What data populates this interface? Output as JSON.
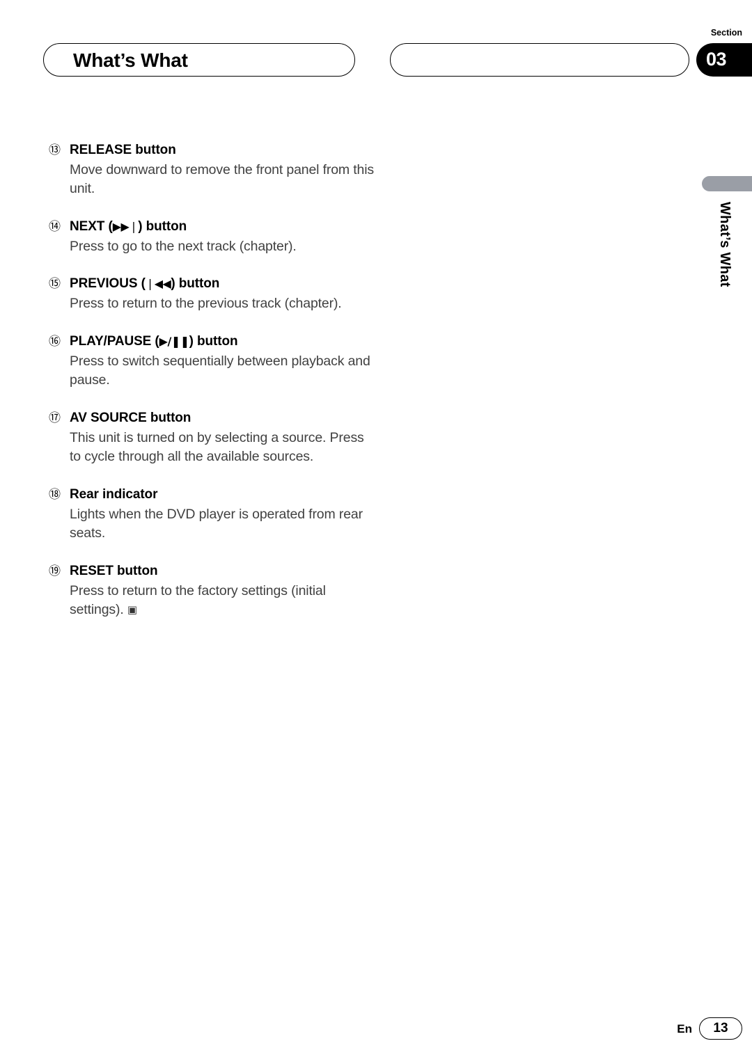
{
  "header": {
    "chapter_title": "What’s What",
    "section_label": "Section",
    "section_number": "03"
  },
  "side_tab": {
    "label": "What’s What",
    "color": "#9a9ea6"
  },
  "entries": [
    {
      "marker": "⑬",
      "title": "RELEASE button",
      "glyph": "",
      "title_suffix": "",
      "body": "Move downward to remove the front panel from this unit."
    },
    {
      "marker": "⑭",
      "title": "NEXT (",
      "glyph": "▶▶❘",
      "title_suffix": ") button",
      "body": "Press to go to the next track (chapter)."
    },
    {
      "marker": "⑮",
      "title": "PREVIOUS (",
      "glyph": "❘◀◀",
      "title_suffix": ") button",
      "body": "Press to return to the previous track (chapter)."
    },
    {
      "marker": "⑯",
      "title": "PLAY/PAUSE (",
      "glyph": "▶/❚❚",
      "title_suffix": ") button",
      "body": "Press to switch sequentially between playback and pause."
    },
    {
      "marker": "⑰",
      "title": "AV SOURCE button",
      "glyph": "",
      "title_suffix": "",
      "body": "This unit is turned on by selecting a source. Press to cycle through all the available sources."
    },
    {
      "marker": "⑱",
      "title": "Rear indicator",
      "glyph": "",
      "title_suffix": "",
      "body": "Lights when the DVD player is operated from rear seats."
    },
    {
      "marker": "⑲",
      "title": "RESET button",
      "glyph": "",
      "title_suffix": "",
      "body": "Press to return to the factory settings (initial settings).",
      "end_mark": "▣"
    }
  ],
  "footer": {
    "language": "En",
    "page_number": "13"
  }
}
